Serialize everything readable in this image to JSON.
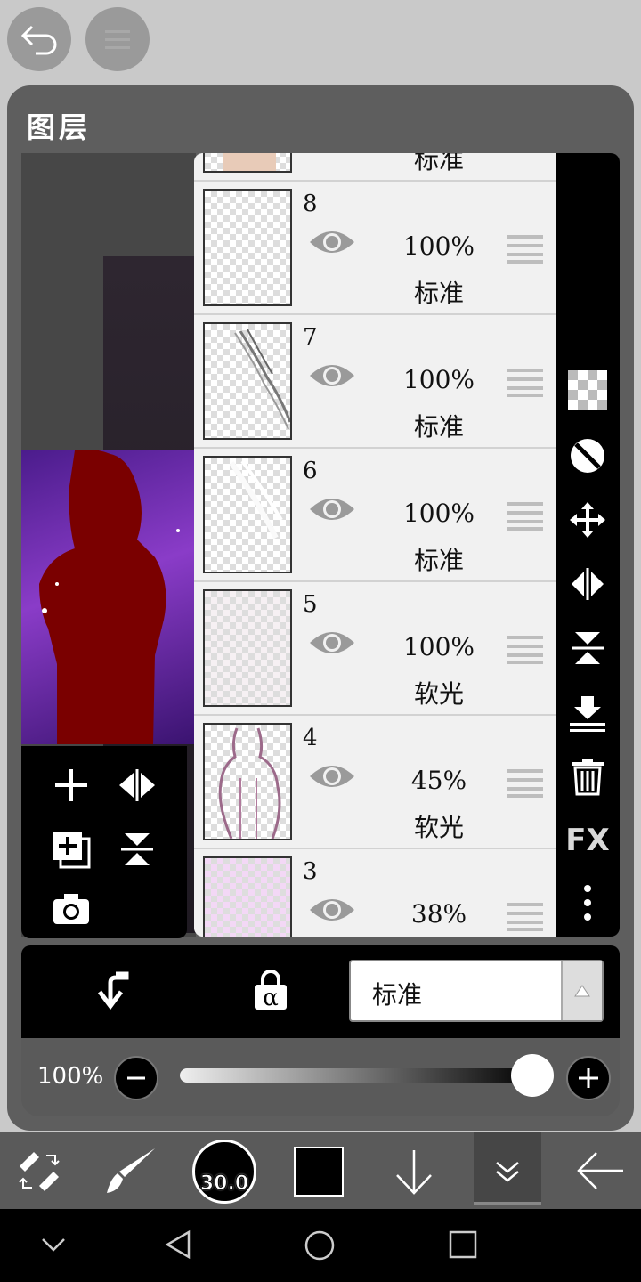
{
  "top": {
    "back_icon": "undo-icon",
    "menu_icon": "menu-icon"
  },
  "panel": {
    "title": "图层"
  },
  "tools": {
    "icons": [
      "add-layer-icon",
      "flip-horizontal-icon",
      "add-copy-icon",
      "flip-vertical-icon",
      "camera-icon"
    ]
  },
  "layers": [
    {
      "num": "8",
      "opacity": "100%",
      "blend": "标准"
    },
    {
      "num": "7",
      "opacity": "100%",
      "blend": "标准"
    },
    {
      "num": "6",
      "opacity": "100%",
      "blend": "标准"
    },
    {
      "num": "5",
      "opacity": "100%",
      "blend": "软光"
    },
    {
      "num": "4",
      "opacity": "45%",
      "blend": "软光"
    },
    {
      "num": "3",
      "opacity": "38%",
      "blend": ""
    }
  ],
  "partial_top_layer": {
    "blend": "标准"
  },
  "right_bar": {
    "icons": [
      "transparency-icon",
      "invert-icon",
      "move-icon",
      "flip-horizontal-icon",
      "flip-vertical-icon",
      "merge-down-icon",
      "trash-icon",
      "fx-icon",
      "more-icon"
    ],
    "fx_label": "FX"
  },
  "blend_bar": {
    "clip_icon": "clip-icon",
    "alpha_lock_icon": "alpha-lock-icon",
    "alpha_symbol": "α",
    "blend_value": "标准"
  },
  "opacity_bar": {
    "value_text": "100%",
    "value": 1.0
  },
  "toolbar": {
    "brush_size": "30.0",
    "color": "#000000",
    "icons": [
      "transform-icon",
      "brush-icon",
      "brush-size-icon",
      "color-icon",
      "arrow-down-icon",
      "collapse-icon",
      "back-arrow-icon"
    ]
  },
  "sys_nav": {
    "icons": [
      "hide-nav-icon",
      "back-triangle-icon",
      "home-circle-icon",
      "recent-square-icon"
    ]
  },
  "colors": {
    "panel_bg": "#5e5e5e",
    "accent_dark_red": "#7a0000",
    "purple": "#8a3cc8"
  }
}
